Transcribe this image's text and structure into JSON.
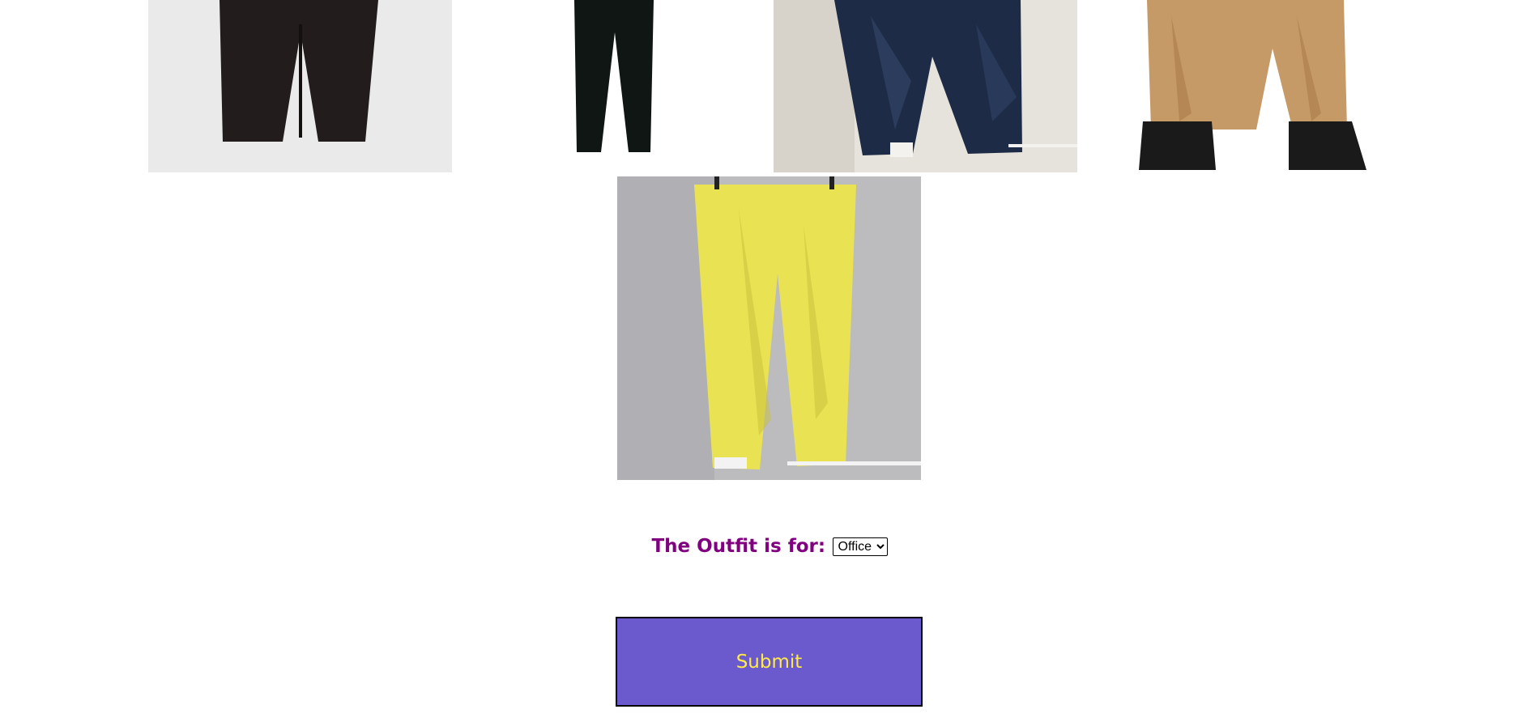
{
  "products": [
    {
      "name": "black-trousers",
      "icon": "black-pants-photo"
    },
    {
      "name": "black-slim-trousers",
      "icon": "black-slim-pants-photo"
    },
    {
      "name": "dark-denim-jeans",
      "icon": "dark-jeans-photo"
    },
    {
      "name": "khaki-chinos",
      "icon": "khaki-chinos-photo"
    },
    {
      "name": "yellow-jeans",
      "icon": "yellow-jeans-photo"
    }
  ],
  "occasion": {
    "label": "The Outfit is for:",
    "selected": "Office"
  },
  "submit": {
    "label": "Submit"
  },
  "colors": {
    "label": "#800080",
    "button_bg": "#6a5acd",
    "button_text": "#ffea4a"
  }
}
